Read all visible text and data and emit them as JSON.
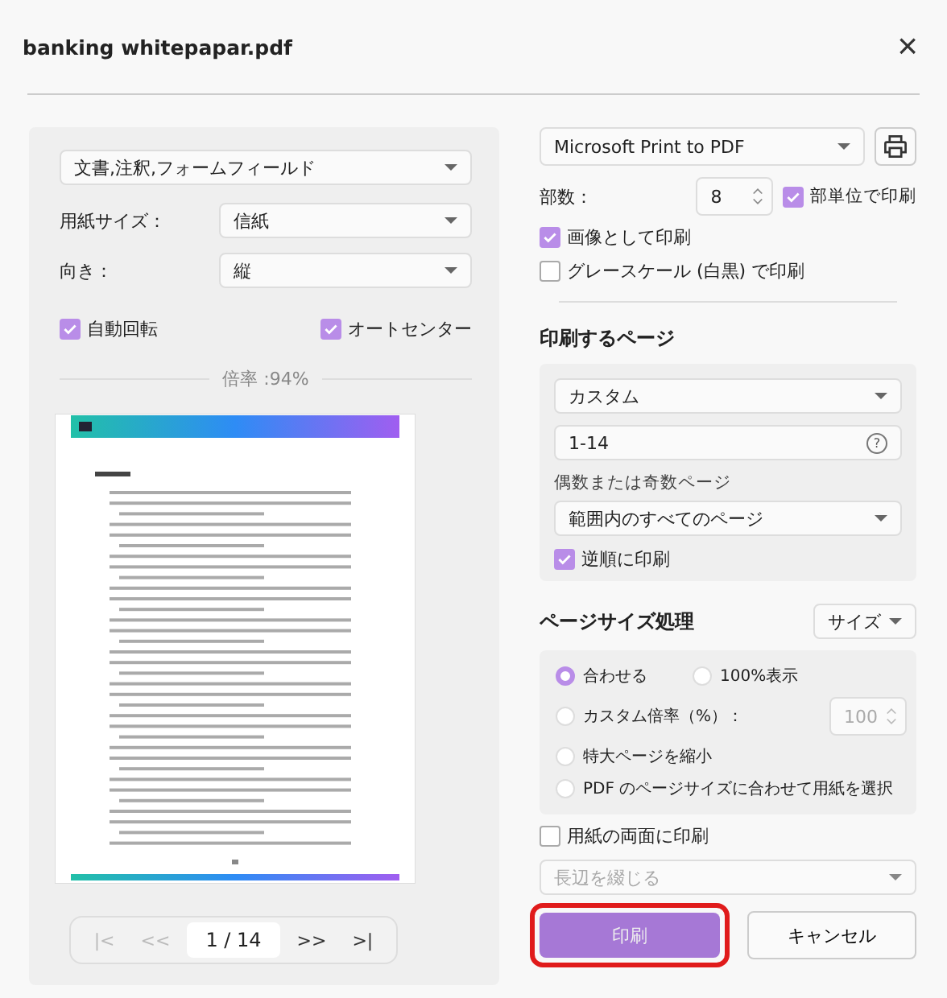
{
  "window": {
    "title": "banking whitepapar.pdf",
    "close_label": "×"
  },
  "left": {
    "content_select": "文書,注釈,フォームフィールド",
    "fields": [
      {
        "label": "用紙サイズ：",
        "value": "信紙"
      },
      {
        "label": "向き：",
        "value": "縦"
      }
    ],
    "options": [
      {
        "label": "自動回転",
        "checked": true
      },
      {
        "label": "オートセンター",
        "checked": true
      }
    ],
    "scale_label": "倍率 :94%",
    "pager": {
      "first": "|<",
      "prev": "<<",
      "current": "1",
      "separator": "/",
      "total": "14",
      "next": ">>",
      "last": ">|"
    }
  },
  "right": {
    "printer": "Microsoft Print to PDF",
    "copies": {
      "label": "部数：",
      "value": "8"
    },
    "collate": {
      "label": "部単位で印刷",
      "checked": true
    },
    "print_options": [
      {
        "label": "画像として印刷",
        "checked": true
      },
      {
        "label": "グレースケール (白黒) で印刷",
        "checked": false
      }
    ],
    "pages_heading": "印刷するページ",
    "range_select": "カスタム",
    "range_value": "1-14",
    "help_label": "?",
    "subset_label": "偶数または奇数ページ",
    "subset_select": "範囲内のすべてのページ",
    "reverse": {
      "label": "逆順に印刷",
      "checked": true
    },
    "size_heading": "ページサイズ処理",
    "size_select": "サイズ",
    "size_options": [
      {
        "label": "合わせる",
        "selected": true
      },
      {
        "label": "100%表示",
        "selected": false
      },
      {
        "label": "カスタム倍率（%）：",
        "selected": false
      },
      {
        "label": "特大ページを縮小",
        "selected": false
      },
      {
        "label": "PDF のページサイズに合わせて用紙を選択",
        "selected": false
      }
    ],
    "custom_scale": "100",
    "duplex": {
      "label": "用紙の両面に印刷",
      "checked": false
    },
    "binding_placeholder": "長辺を綴じる",
    "print_button": "印刷",
    "cancel_button": "キャンセル",
    "print_highlighted": true
  }
}
